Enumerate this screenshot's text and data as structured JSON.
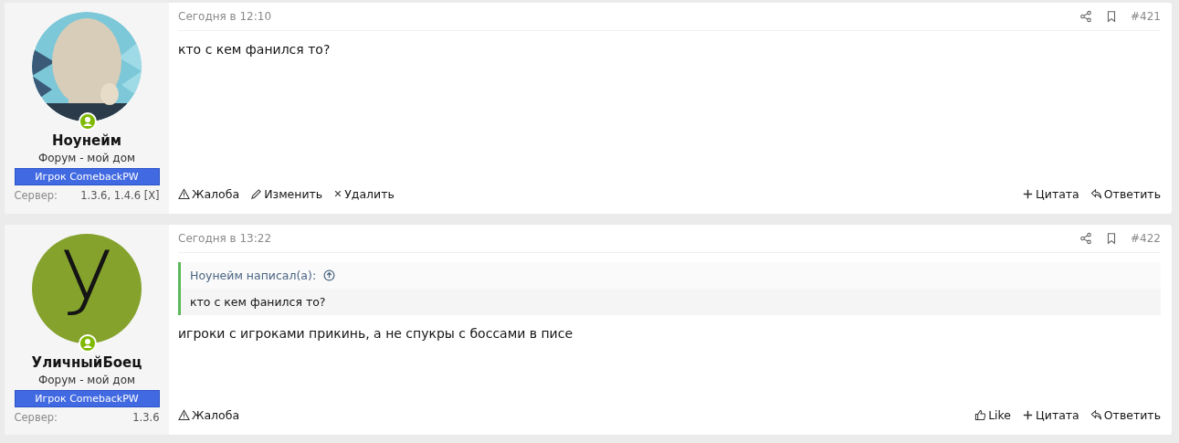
{
  "posts": [
    {
      "author": {
        "name": "Ноунейм",
        "online": true,
        "title": "Форум - мой дом",
        "banner": "Игрок ComebackPW",
        "server_label": "Сервер:",
        "server_value": "1.3.6, 1.4.6 [X]"
      },
      "date": "Сегодня в 12:10",
      "number": "#421",
      "body": "кто с кем фанился то?",
      "actions_left": [
        {
          "kind": "report",
          "label": "Жалоба"
        },
        {
          "kind": "edit",
          "label": "Изменить"
        },
        {
          "kind": "delete",
          "label": "Удалить"
        }
      ],
      "actions_right": [
        {
          "kind": "quote",
          "label": "Цитата"
        },
        {
          "kind": "reply",
          "label": "Ответить"
        }
      ]
    },
    {
      "author": {
        "name": "УличныйБоец",
        "avatar": {
          "kind": "letter",
          "letter": "У",
          "color": "#85a22d"
        },
        "online": true,
        "title": "Форум - мой дом",
        "banner": "Игрок ComebackPW",
        "server_label": "Сервер:",
        "server_value": "1.3.6"
      },
      "date": "Сегодня в 13:22",
      "number": "#422",
      "quote": {
        "attribution": "Ноунейм написал(а):",
        "text": "кто с кем фанился то?"
      },
      "body": "игроки с игроками прикинь, а не спукры с боссами в писе",
      "actions_left": [
        {
          "kind": "report",
          "label": "Жалоба"
        }
      ],
      "actions_right": [
        {
          "kind": "like",
          "label": "Like"
        },
        {
          "kind": "quote",
          "label": "Цитата"
        },
        {
          "kind": "reply",
          "label": "Ответить"
        }
      ]
    }
  ]
}
